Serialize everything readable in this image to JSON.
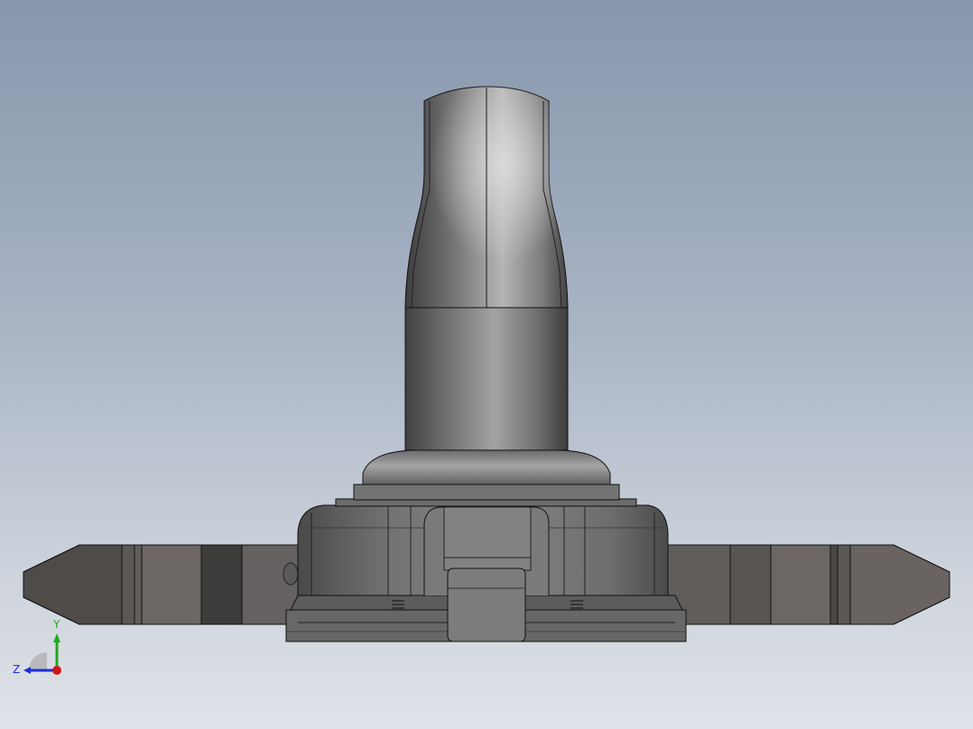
{
  "viewport": {
    "view": "front-orthographic",
    "background_top": "#8797ad",
    "background_bottom": "#dfe3e8",
    "model_color": "#6f6f6f"
  },
  "triad": {
    "y_label": "Y",
    "z_label": "Z",
    "y_color": "#1ea81e",
    "z_color": "#1c2fd6",
    "x_color": "#d01818"
  }
}
